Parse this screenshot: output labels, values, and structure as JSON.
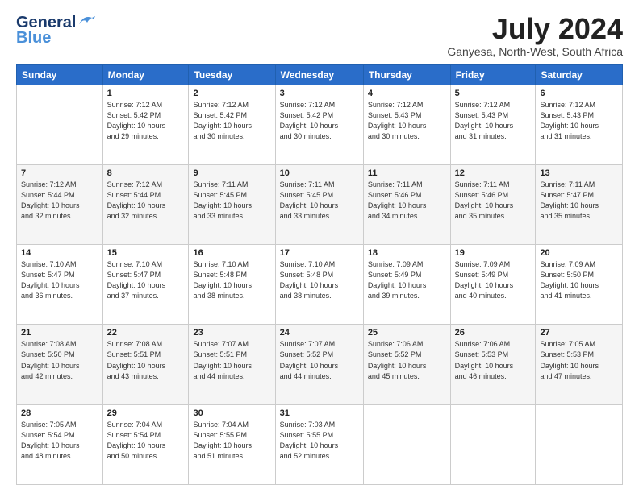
{
  "logo": {
    "line1": "General",
    "line2": "Blue"
  },
  "title": "July 2024",
  "subtitle": "Ganyesa, North-West, South Africa",
  "days_header": [
    "Sunday",
    "Monday",
    "Tuesday",
    "Wednesday",
    "Thursday",
    "Friday",
    "Saturday"
  ],
  "weeks": [
    [
      {
        "day": "",
        "info": ""
      },
      {
        "day": "1",
        "info": "Sunrise: 7:12 AM\nSunset: 5:42 PM\nDaylight: 10 hours\nand 29 minutes."
      },
      {
        "day": "2",
        "info": "Sunrise: 7:12 AM\nSunset: 5:42 PM\nDaylight: 10 hours\nand 30 minutes."
      },
      {
        "day": "3",
        "info": "Sunrise: 7:12 AM\nSunset: 5:42 PM\nDaylight: 10 hours\nand 30 minutes."
      },
      {
        "day": "4",
        "info": "Sunrise: 7:12 AM\nSunset: 5:43 PM\nDaylight: 10 hours\nand 30 minutes."
      },
      {
        "day": "5",
        "info": "Sunrise: 7:12 AM\nSunset: 5:43 PM\nDaylight: 10 hours\nand 31 minutes."
      },
      {
        "day": "6",
        "info": "Sunrise: 7:12 AM\nSunset: 5:43 PM\nDaylight: 10 hours\nand 31 minutes."
      }
    ],
    [
      {
        "day": "7",
        "info": "Sunrise: 7:12 AM\nSunset: 5:44 PM\nDaylight: 10 hours\nand 32 minutes."
      },
      {
        "day": "8",
        "info": "Sunrise: 7:12 AM\nSunset: 5:44 PM\nDaylight: 10 hours\nand 32 minutes."
      },
      {
        "day": "9",
        "info": "Sunrise: 7:11 AM\nSunset: 5:45 PM\nDaylight: 10 hours\nand 33 minutes."
      },
      {
        "day": "10",
        "info": "Sunrise: 7:11 AM\nSunset: 5:45 PM\nDaylight: 10 hours\nand 33 minutes."
      },
      {
        "day": "11",
        "info": "Sunrise: 7:11 AM\nSunset: 5:46 PM\nDaylight: 10 hours\nand 34 minutes."
      },
      {
        "day": "12",
        "info": "Sunrise: 7:11 AM\nSunset: 5:46 PM\nDaylight: 10 hours\nand 35 minutes."
      },
      {
        "day": "13",
        "info": "Sunrise: 7:11 AM\nSunset: 5:47 PM\nDaylight: 10 hours\nand 35 minutes."
      }
    ],
    [
      {
        "day": "14",
        "info": "Sunrise: 7:10 AM\nSunset: 5:47 PM\nDaylight: 10 hours\nand 36 minutes."
      },
      {
        "day": "15",
        "info": "Sunrise: 7:10 AM\nSunset: 5:47 PM\nDaylight: 10 hours\nand 37 minutes."
      },
      {
        "day": "16",
        "info": "Sunrise: 7:10 AM\nSunset: 5:48 PM\nDaylight: 10 hours\nand 38 minutes."
      },
      {
        "day": "17",
        "info": "Sunrise: 7:10 AM\nSunset: 5:48 PM\nDaylight: 10 hours\nand 38 minutes."
      },
      {
        "day": "18",
        "info": "Sunrise: 7:09 AM\nSunset: 5:49 PM\nDaylight: 10 hours\nand 39 minutes."
      },
      {
        "day": "19",
        "info": "Sunrise: 7:09 AM\nSunset: 5:49 PM\nDaylight: 10 hours\nand 40 minutes."
      },
      {
        "day": "20",
        "info": "Sunrise: 7:09 AM\nSunset: 5:50 PM\nDaylight: 10 hours\nand 41 minutes."
      }
    ],
    [
      {
        "day": "21",
        "info": "Sunrise: 7:08 AM\nSunset: 5:50 PM\nDaylight: 10 hours\nand 42 minutes."
      },
      {
        "day": "22",
        "info": "Sunrise: 7:08 AM\nSunset: 5:51 PM\nDaylight: 10 hours\nand 43 minutes."
      },
      {
        "day": "23",
        "info": "Sunrise: 7:07 AM\nSunset: 5:51 PM\nDaylight: 10 hours\nand 44 minutes."
      },
      {
        "day": "24",
        "info": "Sunrise: 7:07 AM\nSunset: 5:52 PM\nDaylight: 10 hours\nand 44 minutes."
      },
      {
        "day": "25",
        "info": "Sunrise: 7:06 AM\nSunset: 5:52 PM\nDaylight: 10 hours\nand 45 minutes."
      },
      {
        "day": "26",
        "info": "Sunrise: 7:06 AM\nSunset: 5:53 PM\nDaylight: 10 hours\nand 46 minutes."
      },
      {
        "day": "27",
        "info": "Sunrise: 7:05 AM\nSunset: 5:53 PM\nDaylight: 10 hours\nand 47 minutes."
      }
    ],
    [
      {
        "day": "28",
        "info": "Sunrise: 7:05 AM\nSunset: 5:54 PM\nDaylight: 10 hours\nand 48 minutes."
      },
      {
        "day": "29",
        "info": "Sunrise: 7:04 AM\nSunset: 5:54 PM\nDaylight: 10 hours\nand 50 minutes."
      },
      {
        "day": "30",
        "info": "Sunrise: 7:04 AM\nSunset: 5:55 PM\nDaylight: 10 hours\nand 51 minutes."
      },
      {
        "day": "31",
        "info": "Sunrise: 7:03 AM\nSunset: 5:55 PM\nDaylight: 10 hours\nand 52 minutes."
      },
      {
        "day": "",
        "info": ""
      },
      {
        "day": "",
        "info": ""
      },
      {
        "day": "",
        "info": ""
      }
    ]
  ]
}
